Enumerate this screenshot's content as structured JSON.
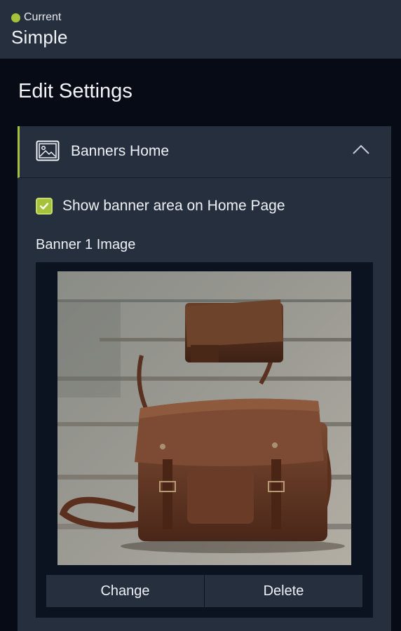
{
  "header": {
    "status_label": "Current",
    "status_color": "#a6c23a",
    "theme_name": "Simple"
  },
  "panel": {
    "title": "Edit Settings"
  },
  "section": {
    "icon": "image-icon",
    "title": "Banners Home",
    "expanded": true,
    "accent_color": "#a6c23a",
    "checkbox": {
      "label": "Show banner area on Home Page",
      "checked": true
    },
    "banner_image": {
      "label": "Banner 1 Image",
      "change_label": "Change",
      "delete_label": "Delete"
    }
  }
}
